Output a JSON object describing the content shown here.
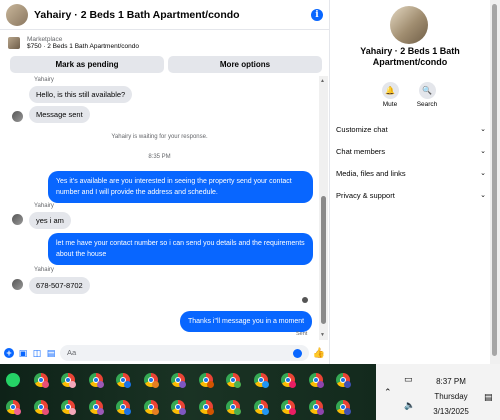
{
  "header": {
    "title": "Yahairy · 2 Beds 1 Bath Apartment/condo",
    "info_icon": "info-icon"
  },
  "marketplace": {
    "label": "Marketplace",
    "listing": "$750 · 2 Beds 1 Bath Apartment/condo",
    "buttons": [
      "Mark as pending",
      "More options"
    ]
  },
  "messages": {
    "m1_sender": "Yahairy",
    "m1": "Hello, is this still available?",
    "m2": "Message sent",
    "system": "Yahairy is waiting for your response.",
    "time": "8:35 PM",
    "m3": "Yes it's available are you interested in seeing the property send your contact number and I will provide the address and schedule.",
    "m4_sender": "Yahairy",
    "m4": "yes i am",
    "m5": "let me have your contact number so i can send you details and the requirements about the house",
    "m6_sender": "Yahairy",
    "m6": "678-507-8702",
    "m7": "Thanks i\"ll message you in a moment",
    "sent": "Sent"
  },
  "composer": {
    "placeholder": "Aa"
  },
  "right_panel": {
    "name": "Yahairy · 2 Beds 1 Bath Apartment/condo",
    "mute": "Mute",
    "search": "Search",
    "items": [
      "Customize chat",
      "Chat members",
      "Media, files and links",
      "Privacy & support"
    ]
  },
  "taskbar": {
    "time": "8:37 PM",
    "day": "Thursday",
    "date": "3/13/2025"
  },
  "colors": {
    "accent": "#0866ff",
    "bubble_in": "#e4e6eb"
  }
}
